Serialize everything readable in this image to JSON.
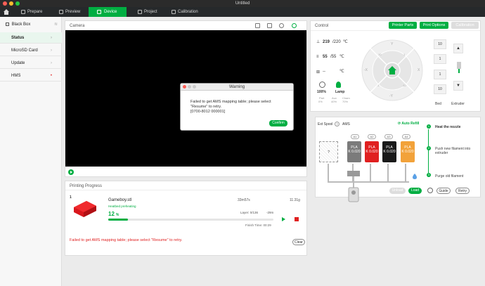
{
  "window": {
    "title": "Untitled"
  },
  "nav": {
    "tabs": [
      {
        "label": "Prepare"
      },
      {
        "label": "Preview"
      },
      {
        "label": "Device"
      },
      {
        "label": "Project"
      },
      {
        "label": "Calibration"
      }
    ]
  },
  "sidebar": {
    "printer": "Black Box",
    "items": [
      {
        "label": "Status"
      },
      {
        "label": "MicroSD Card"
      },
      {
        "label": "Update"
      },
      {
        "label": "HMS"
      }
    ]
  },
  "camera": {
    "title": "Camera"
  },
  "dialog": {
    "title": "Warning",
    "message": "Failed to get AMS mapping table; please select \"Resume\" to retry.",
    "code": "[0700-8012 000001]",
    "confirm": "Confirm"
  },
  "progress": {
    "title": "Printing Progress",
    "plate": "1",
    "filename": "Gameboy.stl",
    "time": "33m57s",
    "weight": "11.31g",
    "status": "Heatbed preheating",
    "percent": "12",
    "percent_unit": "%",
    "percent_value": 0.12,
    "layer": "Layer: 0/136",
    "remaining": "-29m",
    "finish": "Finish Time: 00:29",
    "error": "Failed to get AMS mapping table; please select \"Resume\" to retry.",
    "clear": "Clear"
  },
  "control": {
    "title": "Control",
    "printer_parts": "Printer Parts",
    "print_options": "Print Options",
    "calibration": "Calibration",
    "nozzle_temp": "219",
    "nozzle_target": "/220",
    "bed_temp": "55",
    "bed_target": "/55",
    "chamber_temp": "--",
    "unit": "℃",
    "speed": "100%",
    "lamp": "Lamp",
    "fans": [
      {
        "name": "Part",
        "value": "0%"
      },
      {
        "name": "Aux",
        "value": "40%"
      },
      {
        "name": "Cham",
        "value": "70%"
      }
    ],
    "jog": {
      "ring_labels": [
        "Y",
        "-Y",
        "-X",
        "X",
        "10",
        "1",
        "-1",
        "-10"
      ],
      "z": [
        "10",
        "1",
        "1",
        "10"
      ],
      "bed": "Bed",
      "extruder": "Extruder"
    }
  },
  "ams": {
    "ext_spool": "Ext Spool",
    "ext_q": "?",
    "label": "AMS",
    "auto_refill": "Auto Refill",
    "slots": [
      {
        "id": "A1",
        "type": "PLA",
        "code": "K 0.020",
        "color": "#7b7b7b"
      },
      {
        "id": "A2",
        "type": "PLA",
        "code": "K 0.020",
        "color": "#e02020"
      },
      {
        "id": "A3",
        "type": "PLA",
        "code": "K 0.020",
        "color": "#1a1a1a"
      },
      {
        "id": "A4",
        "type": "PLA",
        "code": "K 0.020",
        "color": "#f2a23a"
      }
    ],
    "steps": [
      {
        "n": "1",
        "label": "Heat the nozzle"
      },
      {
        "n": "2",
        "label": "Push new filament into extruder"
      },
      {
        "n": "3",
        "label": "Purge old filament"
      }
    ],
    "unload": "Unload",
    "load": "Load",
    "guide": "Guide",
    "retry": "Retry"
  }
}
